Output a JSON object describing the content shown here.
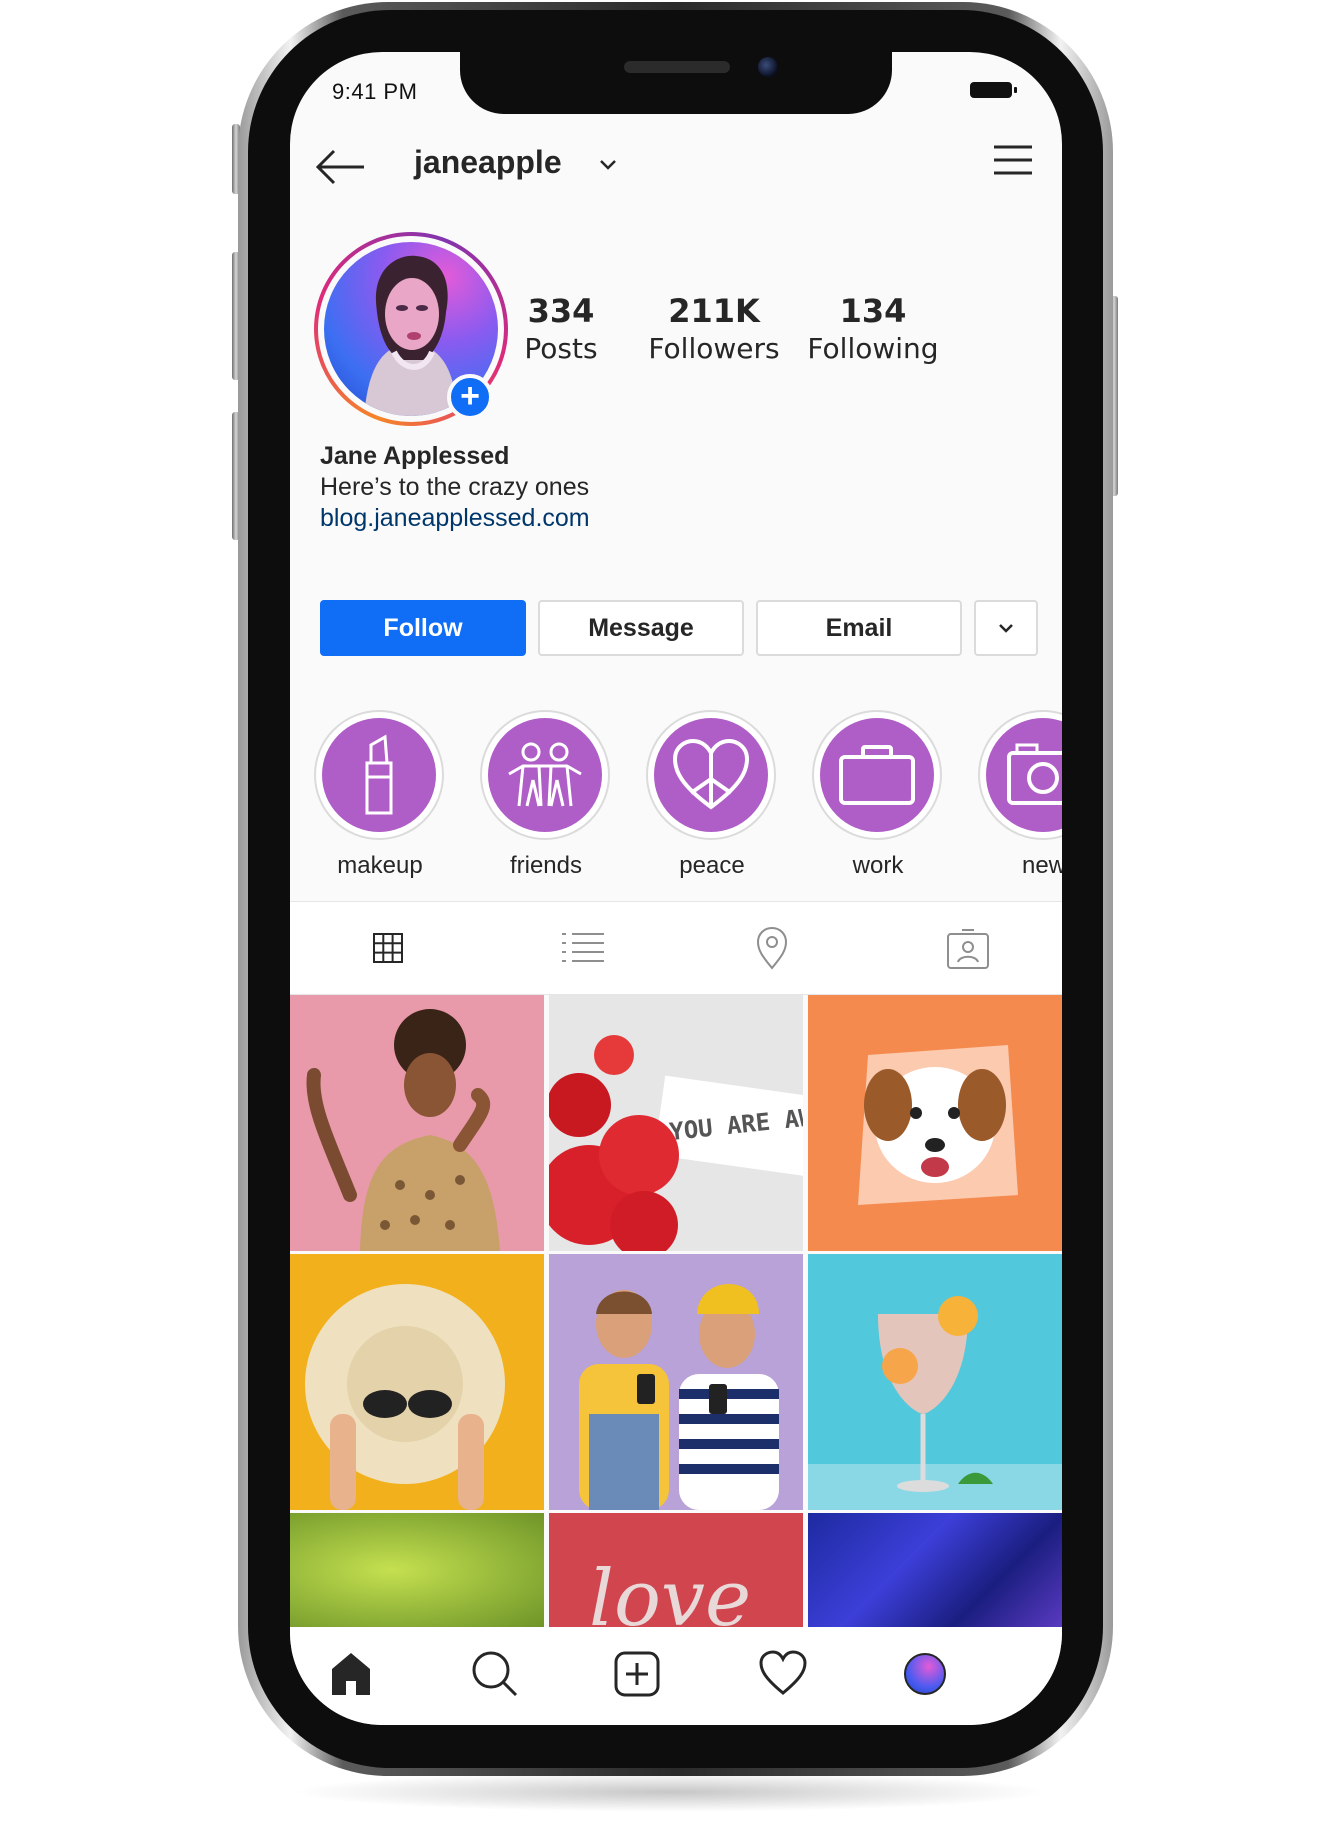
{
  "status": {
    "time": "9:41 PM"
  },
  "header": {
    "username": "janeapple"
  },
  "profile": {
    "stats": [
      {
        "value": "334",
        "label": "Posts"
      },
      {
        "value": "211K",
        "label": "Followers"
      },
      {
        "value": "134",
        "label": "Following"
      }
    ],
    "name": "Jane Applessed",
    "bio": "Here’s to the crazy ones",
    "link": "blog.janeapplessed.com"
  },
  "actions": {
    "follow": "Follow",
    "message": "Message",
    "email": "Email"
  },
  "highlights": [
    {
      "label": "makeup",
      "icon": "lipstick-icon"
    },
    {
      "label": "friends",
      "icon": "friends-icon"
    },
    {
      "label": "peace",
      "icon": "peace-heart-icon"
    },
    {
      "label": "work",
      "icon": "briefcase-icon"
    },
    {
      "label": "new",
      "icon": "camera-icon"
    }
  ],
  "grid_text": {
    "awesome_card": "YOU ARE AWES",
    "love_word": "love"
  },
  "colors": {
    "accent": "#0f6ef5",
    "highlight": "#b05ec7",
    "link": "#00376b"
  }
}
